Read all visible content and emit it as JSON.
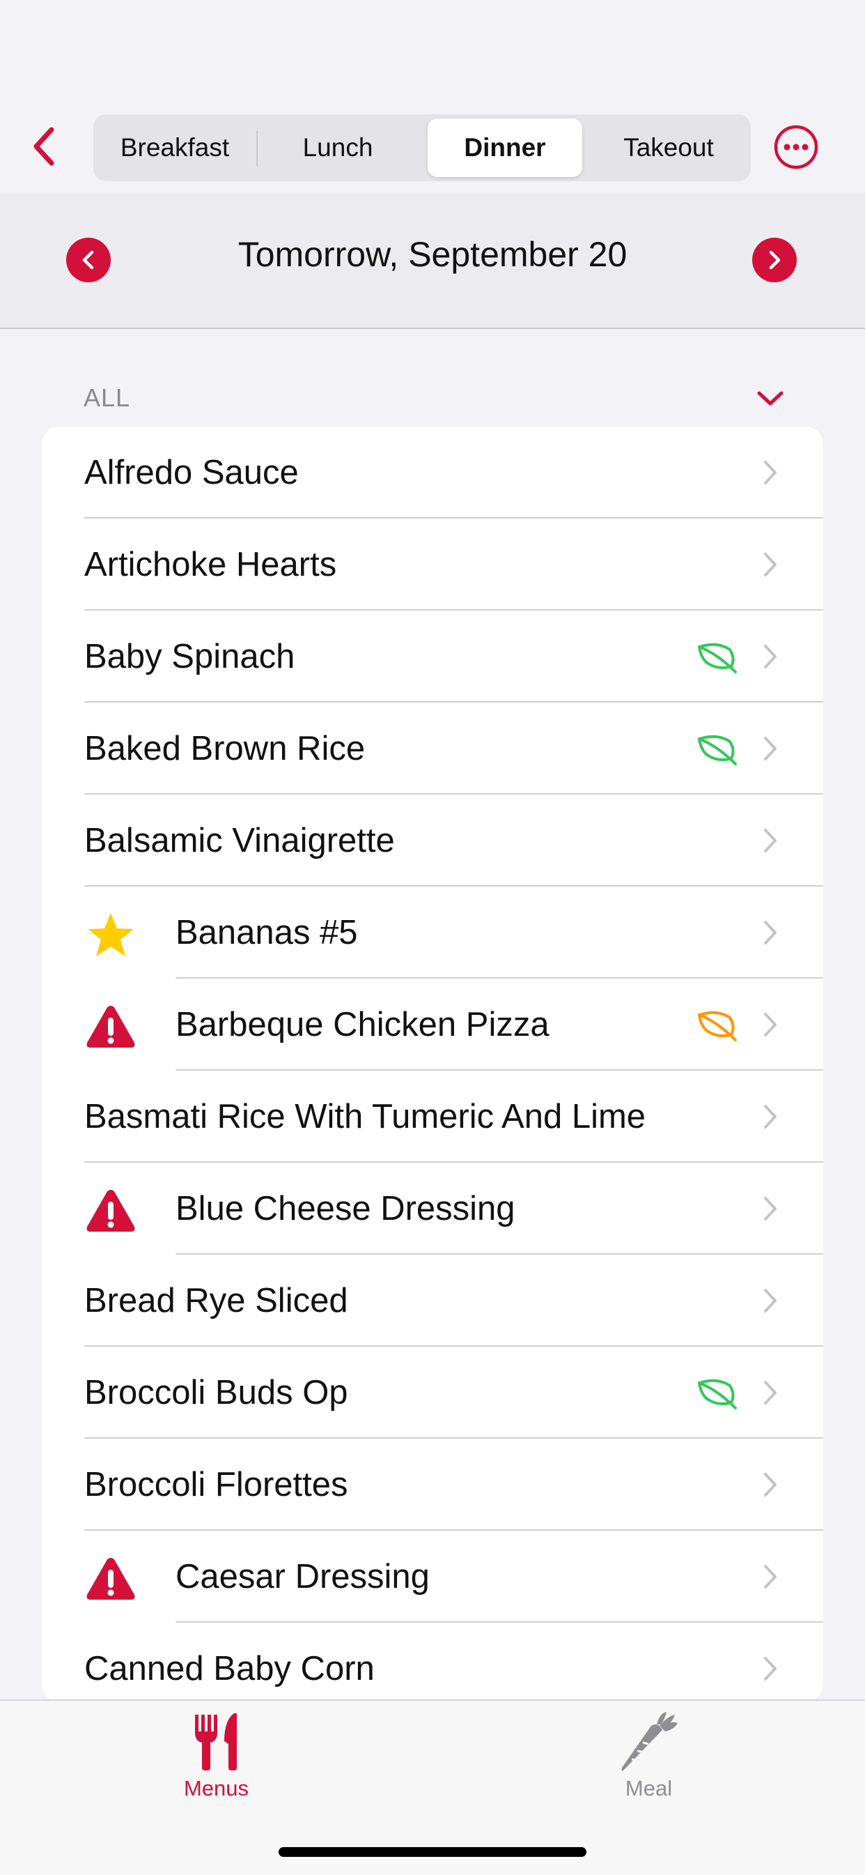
{
  "colors": {
    "accent": "#d2103a",
    "leaf_green": "#34c759",
    "leaf_orange": "#ff9500",
    "star": "#ffcc00"
  },
  "nav": {
    "back_icon": "chevron-left-icon",
    "more_icon": "ellipsis-circle-icon"
  },
  "meal_tabs": [
    {
      "label": "Breakfast",
      "selected": false
    },
    {
      "label": "Lunch",
      "selected": false
    },
    {
      "label": "Dinner",
      "selected": true
    },
    {
      "label": "Takeout",
      "selected": false
    }
  ],
  "date_bar": {
    "label": "Tomorrow, September 20",
    "prev_icon": "chevron-left-circle-icon",
    "next_icon": "chevron-right-circle-icon"
  },
  "section": {
    "title": "ALL",
    "toggle_icon": "chevron-down-icon"
  },
  "items": [
    {
      "label": "Alfredo Sauce",
      "lead_icon": "",
      "leaf": ""
    },
    {
      "label": "Artichoke Hearts",
      "lead_icon": "",
      "leaf": ""
    },
    {
      "label": "Baby Spinach",
      "lead_icon": "",
      "leaf": "green"
    },
    {
      "label": "Baked Brown Rice",
      "lead_icon": "",
      "leaf": "green"
    },
    {
      "label": "Balsamic Vinaigrette",
      "lead_icon": "",
      "leaf": ""
    },
    {
      "label": "Bananas #5",
      "lead_icon": "star",
      "leaf": ""
    },
    {
      "label": "Barbeque Chicken Pizza",
      "lead_icon": "warning",
      "leaf": "orange"
    },
    {
      "label": "Basmati Rice With Tumeric And Lime",
      "lead_icon": "",
      "leaf": ""
    },
    {
      "label": "Blue Cheese Dressing",
      "lead_icon": "warning",
      "leaf": ""
    },
    {
      "label": "Bread Rye Sliced",
      "lead_icon": "",
      "leaf": ""
    },
    {
      "label": "Broccoli Buds Op",
      "lead_icon": "",
      "leaf": "green"
    },
    {
      "label": "Broccoli Florettes",
      "lead_icon": "",
      "leaf": ""
    },
    {
      "label": "Caesar Dressing",
      "lead_icon": "warning",
      "leaf": ""
    },
    {
      "label": "Canned Baby Corn",
      "lead_icon": "",
      "leaf": ""
    }
  ],
  "tabbar": [
    {
      "label": "Menus",
      "icon": "fork-knife-icon",
      "selected": true
    },
    {
      "label": "Meal",
      "icon": "carrot-icon",
      "selected": false
    }
  ]
}
